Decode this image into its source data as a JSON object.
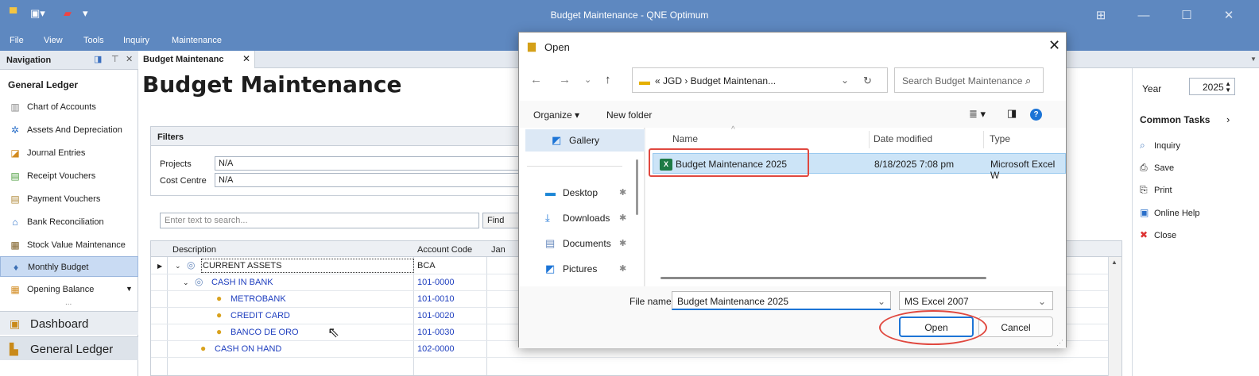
{
  "app": {
    "title": "Budget Maintenance - QNE Optimum",
    "window_controls": {
      "restore": "⊞",
      "minimize": "—",
      "maximize": "☐",
      "close": "✕"
    }
  },
  "menu": [
    "File",
    "View",
    "Tools",
    "Inquiry",
    "Maintenance"
  ],
  "navigation": {
    "header": "Navigation",
    "section": "General Ledger",
    "items": [
      {
        "label": "Chart of Accounts",
        "icon": "chart-of-accounts-icon"
      },
      {
        "label": "Assets And Depreciation",
        "icon": "gear-icon"
      },
      {
        "label": "Journal Entries",
        "icon": "journal-icon"
      },
      {
        "label": "Receipt Vouchers",
        "icon": "receipt-icon"
      },
      {
        "label": "Payment Vouchers",
        "icon": "payment-icon"
      },
      {
        "label": "Bank Reconciliation",
        "icon": "bank-icon"
      },
      {
        "label": "Stock Value Maintenance",
        "icon": "stock-icon"
      },
      {
        "label": "Monthly Budget",
        "icon": "money-bag-icon"
      },
      {
        "label": "Opening Balance",
        "icon": "table-icon"
      }
    ],
    "more": "...",
    "bottom": [
      {
        "label": "Dashboard",
        "icon": "dashboard-icon"
      },
      {
        "label": "General Ledger",
        "icon": "ledger-icon"
      }
    ]
  },
  "doc_tab": {
    "label": "Budget Maintenanc",
    "close": "✕"
  },
  "page_title": "Budget Maintenance",
  "filters": {
    "header": "Filters",
    "projects_label": "Projects",
    "projects_value": "N/A",
    "cost_centre_label": "Cost Centre",
    "cost_centre_value": "N/A"
  },
  "search": {
    "placeholder": "Enter text to search...",
    "find_label": "Find"
  },
  "grid": {
    "columns": [
      "Description",
      "Account Code",
      "Jan"
    ],
    "rows": [
      {
        "description": "CURRENT ASSETS",
        "code": "BCA"
      },
      {
        "description": "CASH IN BANK",
        "code": "101-0000"
      },
      {
        "description": "METROBANK",
        "code": "101-0010"
      },
      {
        "description": "CREDIT CARD",
        "code": "101-0020"
      },
      {
        "description": "BANCO DE ORO",
        "code": "101-0030"
      },
      {
        "description": "CASH ON HAND",
        "code": "102-0000"
      }
    ]
  },
  "right_panel": {
    "year_label": "Year",
    "year_value": "2025",
    "common_tasks": "Common Tasks",
    "tasks": [
      {
        "label": "Inquiry",
        "icon": "inquiry-icon"
      },
      {
        "label": "Save",
        "icon": "save-icon"
      },
      {
        "label": "Print",
        "icon": "print-icon"
      },
      {
        "label": "Online Help",
        "icon": "help-icon"
      },
      {
        "label": "Close",
        "icon": "close-icon"
      }
    ]
  },
  "dialog": {
    "title": "Open",
    "breadcrumb": "«  JGD  ›  Budget Maintenan...",
    "search_placeholder": "Search Budget Maintenance",
    "organize": "Organize ▾",
    "new_folder": "New folder",
    "sidebar": [
      {
        "label": "Gallery",
        "icon": "gallery-icon"
      },
      {
        "label": "Desktop",
        "icon": "desktop-icon"
      },
      {
        "label": "Downloads",
        "icon": "download-icon"
      },
      {
        "label": "Documents",
        "icon": "documents-icon"
      },
      {
        "label": "Pictures",
        "icon": "pictures-icon"
      }
    ],
    "columns": {
      "name": "Name",
      "date": "Date modified",
      "type": "Type"
    },
    "files": [
      {
        "name": "Budget Maintenance 2025",
        "date": "8/18/2025 7:08 pm",
        "type": "Microsoft Excel W"
      }
    ],
    "file_name_label": "File name:",
    "file_name_value": "Budget Maintenance 2025",
    "file_type": "MS Excel 2007",
    "open_label": "Open",
    "cancel_label": "Cancel"
  },
  "colors": {
    "title_bar": "#5e88c0",
    "accent": "#1c74d6",
    "annotation": "#e0483f",
    "selection": "#cce4f7"
  }
}
